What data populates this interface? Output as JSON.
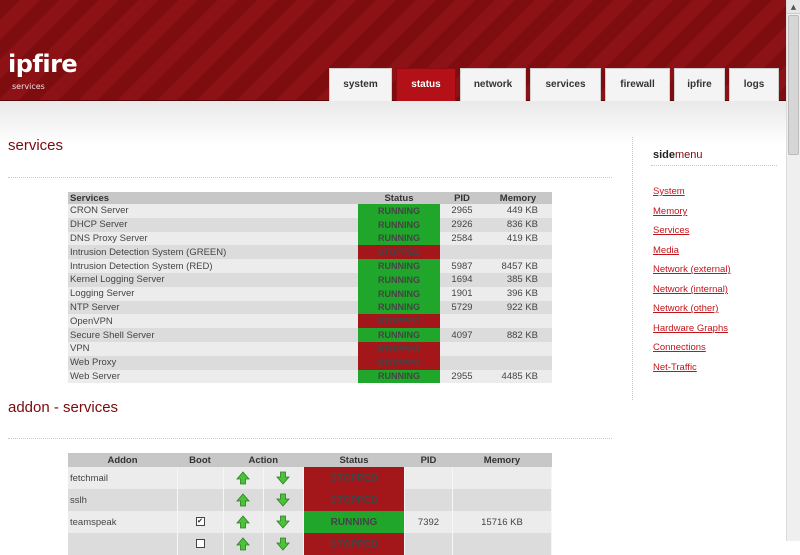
{
  "brand": {
    "title": "ipfire",
    "subtitle": "services"
  },
  "tabs": [
    {
      "label": "system"
    },
    {
      "label": "status",
      "active": true
    },
    {
      "label": "network"
    },
    {
      "label": "services"
    },
    {
      "label": "firewall"
    },
    {
      "label": "ipfire"
    },
    {
      "label": "logs"
    }
  ],
  "services_section": {
    "title": "services",
    "headers": {
      "service": "Services",
      "status": "Status",
      "pid": "PID",
      "memory": "Memory"
    },
    "rows": [
      {
        "name": "CRON Server",
        "status": "RUNNING",
        "pid": "2965",
        "memory": "449 KB"
      },
      {
        "name": "DHCP Server",
        "status": "RUNNING",
        "pid": "2926",
        "memory": "836 KB"
      },
      {
        "name": "DNS Proxy Server",
        "status": "RUNNING",
        "pid": "2584",
        "memory": "419 KB"
      },
      {
        "name": "Intrusion Detection System (GREEN)",
        "status": "STOPPED",
        "pid": "",
        "memory": ""
      },
      {
        "name": "Intrusion Detection System (RED)",
        "status": "RUNNING",
        "pid": "5987",
        "memory": "8457 KB"
      },
      {
        "name": "Kernel Logging Server",
        "status": "RUNNING",
        "pid": "1694",
        "memory": "385 KB"
      },
      {
        "name": "Logging Server",
        "status": "RUNNING",
        "pid": "1901",
        "memory": "396 KB"
      },
      {
        "name": "NTP Server",
        "status": "RUNNING",
        "pid": "5729",
        "memory": "922 KB"
      },
      {
        "name": "OpenVPN",
        "status": "STOPPED",
        "pid": "",
        "memory": ""
      },
      {
        "name": "Secure Shell Server",
        "status": "RUNNING",
        "pid": "4097",
        "memory": "882 KB"
      },
      {
        "name": "VPN",
        "status": "STOPPED",
        "pid": "",
        "memory": ""
      },
      {
        "name": "Web Proxy",
        "status": "STOPPED",
        "pid": "",
        "memory": ""
      },
      {
        "name": "Web Server",
        "status": "RUNNING",
        "pid": "2955",
        "memory": "4485 KB"
      }
    ]
  },
  "addon_section": {
    "title": "addon - services",
    "headers": {
      "addon": "Addon",
      "boot": "Boot",
      "action": "Action",
      "status": "Status",
      "pid": "PID",
      "memory": "Memory"
    },
    "rows": [
      {
        "name": "fetchmail",
        "boot": false,
        "status": "STOPPED",
        "pid": "",
        "memory": ""
      },
      {
        "name": "sslh",
        "boot": false,
        "status": "STOPPED",
        "pid": "",
        "memory": ""
      },
      {
        "name": "teamspeak",
        "boot": true,
        "status": "RUNNING",
        "pid": "7392",
        "memory": "15716 KB"
      },
      {
        "name": "",
        "boot": false,
        "status": "STOPPED",
        "pid": "",
        "memory": ""
      }
    ]
  },
  "sidemenu": {
    "title_bold": "side",
    "title_rest": "menu",
    "items": [
      "System",
      "Memory",
      "Services",
      "Media",
      "Network (external)",
      "Network (internal)",
      "Network (other)",
      "Hardware Graphs",
      "Connections",
      "Net-Traffic"
    ]
  },
  "colors": {
    "header": "#7e0d10",
    "running": "#1fa62b",
    "stopped": "#a3171b",
    "link": "#c4141b"
  }
}
